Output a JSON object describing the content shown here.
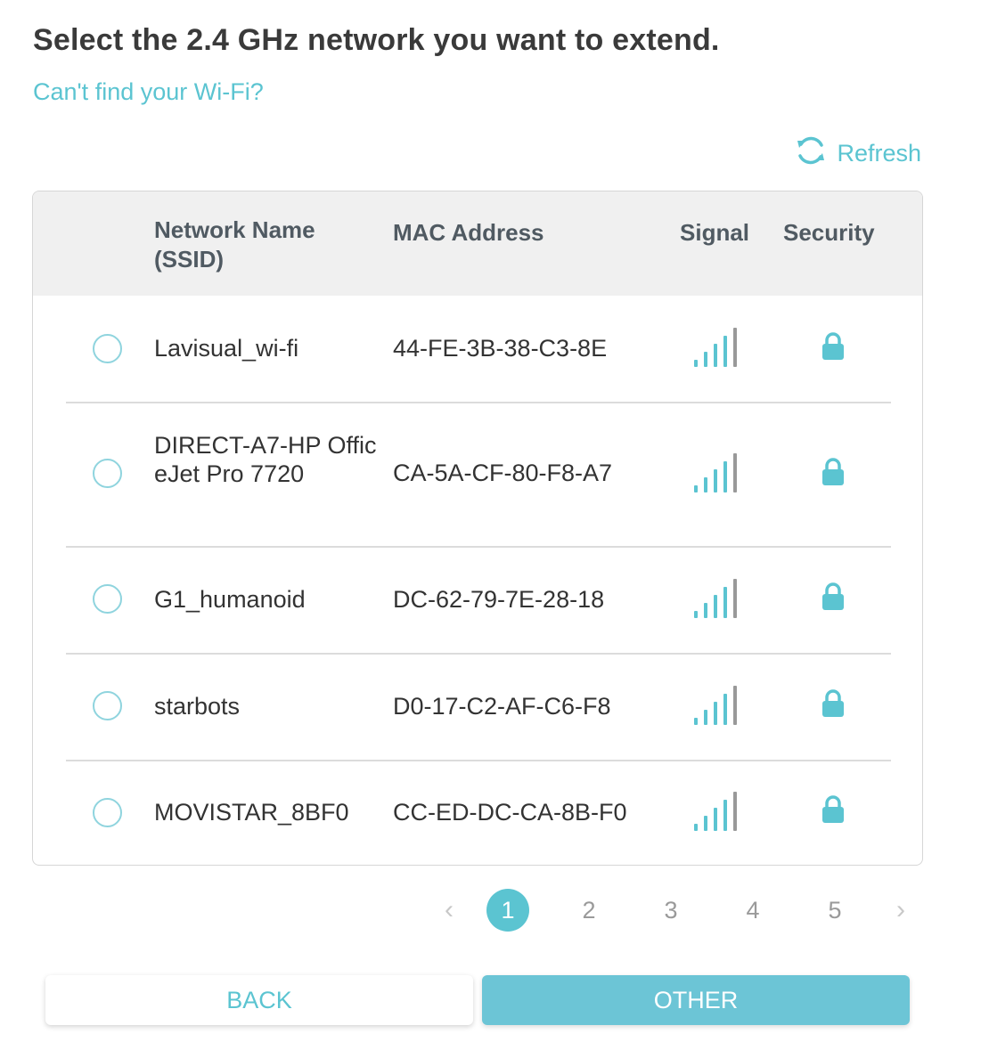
{
  "header": {
    "title": "Select the 2.4 GHz network you want to extend.",
    "cant_find_link": "Can't find your Wi-Fi?",
    "refresh_label": "Refresh"
  },
  "table": {
    "columns": {
      "ssid": "Network Name (SSID)",
      "mac": "MAC Address",
      "signal": "Signal",
      "security": "Security"
    },
    "rows": [
      {
        "ssid": "Lavisual_wi-fi",
        "mac": "44-FE-3B-38-C3-8E",
        "signal_bars": 4,
        "security_icon": "lock-icon"
      },
      {
        "ssid": "DIRECT-A7-HP OfficeJet Pro 7720",
        "mac": "CA-5A-CF-80-F8-A7",
        "signal_bars": 4,
        "security_icon": "lock-icon"
      },
      {
        "ssid": "G1_humanoid",
        "mac": "DC-62-79-7E-28-18",
        "signal_bars": 4,
        "security_icon": "lock-icon"
      },
      {
        "ssid": "starbots",
        "mac": "D0-17-C2-AF-C6-F8",
        "signal_bars": 4,
        "security_icon": "lock-icon"
      },
      {
        "ssid": "MOVISTAR_8BF0",
        "mac": "CC-ED-DC-CA-8B-F0",
        "signal_bars": 4,
        "security_icon": "lock-icon"
      }
    ]
  },
  "pagination": {
    "prev_icon": "chevron-left-icon",
    "next_icon": "chevron-right-icon",
    "pages": [
      "1",
      "2",
      "3",
      "4",
      "5"
    ],
    "current": "1"
  },
  "buttons": {
    "back": "BACK",
    "other": "OTHER"
  },
  "colors": {
    "accent": "#5bc4d1",
    "signal_bar_active": "#5bc4d1",
    "signal_bar_inactive": "#999999",
    "header_bg": "#f0f0f0"
  }
}
